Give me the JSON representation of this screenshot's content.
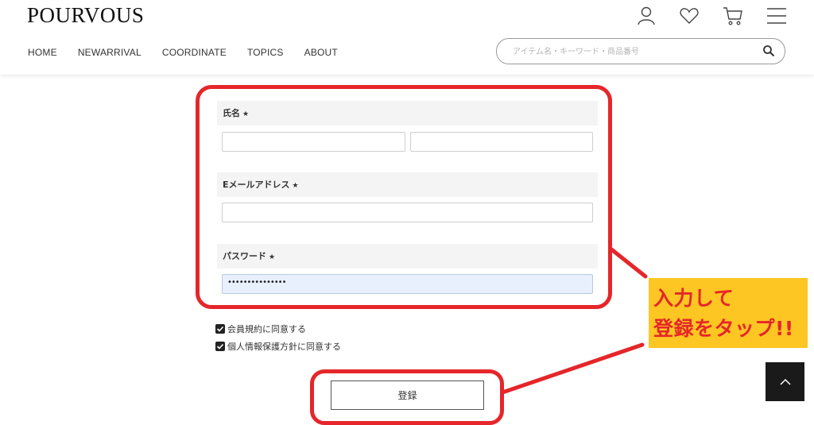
{
  "brand": {
    "logo": "POURVOUS"
  },
  "header": {
    "icons": [
      "user-icon",
      "heart-icon",
      "cart-icon",
      "menu-icon"
    ],
    "nav": [
      {
        "label": "HOME"
      },
      {
        "label": "NEWARRIVAL"
      },
      {
        "label": "COORDINATE"
      },
      {
        "label": "TOPICS"
      },
      {
        "label": "ABOUT"
      }
    ],
    "search": {
      "placeholder": "アイテム名・キーワード・商品番号"
    }
  },
  "form": {
    "name": {
      "label": "氏名",
      "required": "★",
      "last_value": "",
      "first_value": ""
    },
    "email": {
      "label": "Eメールアドレス",
      "required": "★",
      "value": ""
    },
    "password": {
      "label": "パスワード",
      "required": "★",
      "masked_value": "•••••••••••••••"
    },
    "agreements": [
      {
        "label": "会員規約に同意する",
        "checked": true
      },
      {
        "label": "個人情報保護方針に同意する",
        "checked": true
      }
    ],
    "submit_label": "登録"
  },
  "annotation": {
    "line1": "入力して",
    "line2": "登録をタップ!!",
    "color": "#e5262a",
    "bg": "#fec622"
  },
  "back_to_top": {
    "icon": "chevron-up-icon"
  }
}
